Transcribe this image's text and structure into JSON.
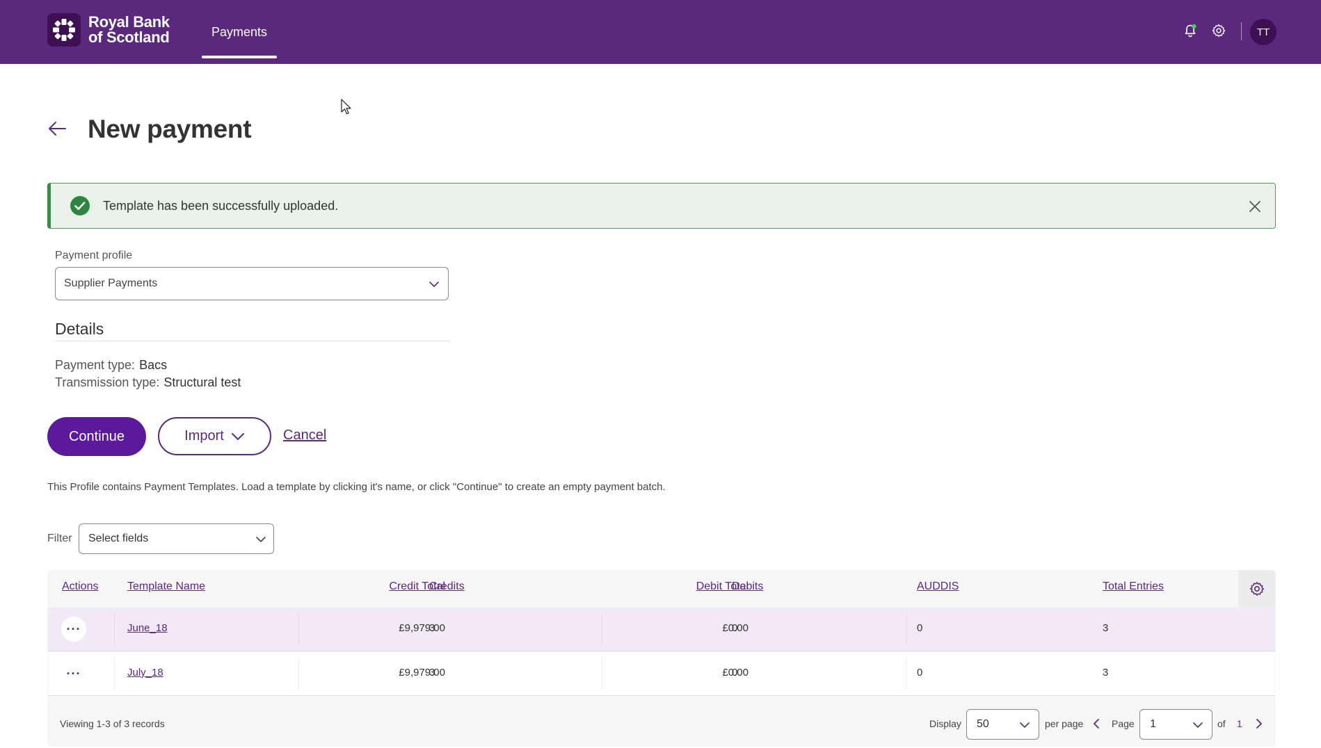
{
  "header": {
    "brand_line1": "Royal Bank",
    "brand_line2": "of Scotland",
    "nav_tab": "Payments",
    "avatar_initials": "TT",
    "icons": [
      "bell-icon",
      "settings-gear-icon"
    ],
    "colors": {
      "brand_purple": "#5a287d",
      "dark_purple": "#3c1053",
      "notification_dot": "#3fd15a"
    }
  },
  "page": {
    "title": "New payment"
  },
  "banner": {
    "message": "Template has been successfully uploaded.",
    "status_color": "#3a8a48"
  },
  "profile": {
    "label": "Payment profile",
    "selected": "Supplier Payments"
  },
  "details": {
    "heading": "Details",
    "payment_type_label": "Payment type:",
    "payment_type_value": "Bacs",
    "transmission_type_label": "Transmission type:",
    "transmission_type_value": "Structural test"
  },
  "actions": {
    "continue_label": "Continue",
    "import_label": "Import",
    "cancel_label": "Cancel"
  },
  "info_text": "This Profile contains Payment Templates. Load a template by clicking it's name, or click \"Continue\" to create an empty payment batch.",
  "filter": {
    "label": "Filter",
    "placeholder": "Select fields"
  },
  "table": {
    "columns": [
      "Actions",
      "Template Name",
      "Credit Total",
      "Credits",
      "Debit Total",
      "Debits",
      "AUDDIS",
      "Total Entries"
    ],
    "rows": [
      {
        "actions": "···",
        "template_name": "June_18",
        "credit_total": "£9,979.00",
        "credits": "3",
        "debit_total": "£0.00",
        "debits": "0",
        "auddis": "0",
        "total_entries": "3"
      },
      {
        "actions": "···",
        "template_name": "July_18",
        "credit_total": "£9,979.00",
        "credits": "3",
        "debit_total": "£0.00",
        "debits": "0",
        "auddis": "0",
        "total_entries": "3"
      }
    ]
  },
  "pagination": {
    "viewing": "Viewing 1-3 of 3 records",
    "display_label": "Display",
    "per_page_value": "50",
    "per_page_label": "per page",
    "page_label": "Page",
    "page_value": "1",
    "of_label": "of",
    "total_pages": "1"
  }
}
